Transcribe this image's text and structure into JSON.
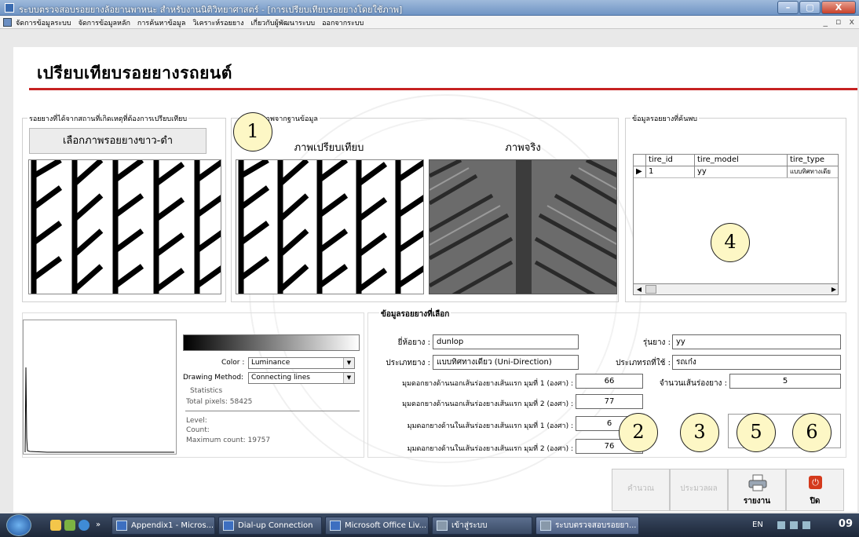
{
  "window": {
    "title": "ระบบตรวจสอบรอยยางล้อยานพาหนะ สำหรับงานนิติวิทยาศาสตร์ - [การเปรียบเทียบรอยยางโดยใช้ภาพ]",
    "min": "–",
    "max": "▢",
    "close": "X"
  },
  "menu": {
    "items": [
      "จัดการข้อมูลระบบ",
      "จัดการข้อมูลหลัก",
      "การค้นหาข้อมูล",
      "วิเคราะห์รอยยาง",
      "เกี่ยวกับผู้พัฒนาระบบ",
      "ออกจากระบบ"
    ],
    "mdi_min": "_",
    "mdi_restore": "▫",
    "mdi_close": "x"
  },
  "page": {
    "title": "เปรียบเทียบรอยยางรถยนต์"
  },
  "left_panel": {
    "label": "รอยยางที่ได้จากสถานที่เกิดเหตุที่ต้องการเปรียบเทียบ",
    "select_button": "เลือกภาพรอยยางขาว-ดำ"
  },
  "middle_panel": {
    "label": "ภาพจากฐานข้อมูล",
    "compare_caption": "ภาพเปรียบเทียบ",
    "real_caption": "ภาพจริง"
  },
  "right_panel": {
    "label": "ข้อมูลรอยยางที่ค้นพบ",
    "columns": [
      "",
      "tire_id",
      "tire_model",
      "tire_type"
    ],
    "rows": [
      {
        "indicator": "▶",
        "tire_id": "1",
        "tire_model": "yy",
        "tire_type": "แบบทิศทางเดีย"
      }
    ]
  },
  "histogram": {
    "color_label": "Color :",
    "color_value": "Luminance",
    "method_label": "Drawing Method:",
    "method_value": "Connecting lines",
    "stats_title": "Statistics",
    "total_pixels": "Total pixels: 58425",
    "level": "Level:",
    "count": "Count:",
    "max_count": "Maximum count: 19757"
  },
  "form": {
    "group_label": "ข้อมูลรอยยางที่เลือก",
    "brand_label": "ยี่ห้อยาง :",
    "brand_value": "dunlop",
    "model_label": "รุ่นยาง :",
    "model_value": "yy",
    "type_label": "ประเภทยาง :",
    "type_value": "แบบทิศทางเดียว (Uni-Direction)",
    "vehicle_label": "ประเภทรถที่ใช้ :",
    "vehicle_value": "รถเก๋ง",
    "angle_out1_label": "มุมดอกยางด้านนอกเส้นร่องยางเส้นแรก มุมที่ 1 (องศา) :",
    "angle_out1_value": "66",
    "grooves_label": "จำนวนเส้นร่องยาง :",
    "grooves_value": "5",
    "angle_out2_label": "มุมดอกยางด้านนอกเส้นร่องยางเส้นแรก มุมที่ 2 (องศา) :",
    "angle_out2_value": "77",
    "angle_in1_label": "มุมดอกยางด้านในเส้นร่องยางเส้นแรก มุมที่ 1 (องศา) :",
    "angle_in1_value": "6",
    "angle_in2_label": "มุมดอกยางด้านในเส้นร่องยางเส้นแรก มุมที่ 2 (องศา) :",
    "angle_in2_value": "76"
  },
  "markers": [
    "1",
    "2",
    "3",
    "4",
    "5",
    "6"
  ],
  "buttons": {
    "calculate": "คำนวณ",
    "evaluate": "ประมวลผล",
    "report": "รายงาน",
    "close": "ปิด"
  },
  "taskbar": {
    "items": [
      "Appendix1 - Micros...",
      "Dial-up Connection",
      "Microsoft Office Liv...",
      "เข้าสู่ระบบ",
      "ระบบตรวจสอบรอยยา..."
    ],
    "lang": "EN",
    "time": "09"
  },
  "colors": {
    "accent_rule": "#c62222",
    "marker_fill": "#fdf7c5",
    "titlebar": "#7fa0cc"
  }
}
